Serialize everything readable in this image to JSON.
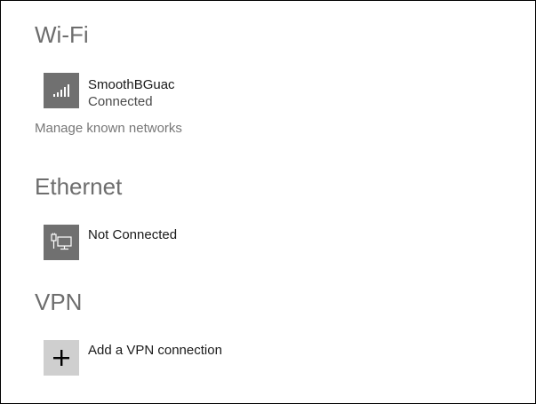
{
  "wifi": {
    "title": "Wi-Fi",
    "network": {
      "name": "SmoothBGuac",
      "status": "Connected",
      "icon": "wifi-signal-icon"
    },
    "manage_link": "Manage known networks"
  },
  "ethernet": {
    "title": "Ethernet",
    "status": "Not Connected",
    "icon": "ethernet-icon"
  },
  "vpn": {
    "title": "VPN",
    "add_label": "Add a VPN connection",
    "icon": "plus-icon"
  },
  "colors": {
    "heading": "#6d6d6d",
    "tile_dark": "#707070",
    "tile_light": "#cfcfcf",
    "link": "#777777"
  }
}
